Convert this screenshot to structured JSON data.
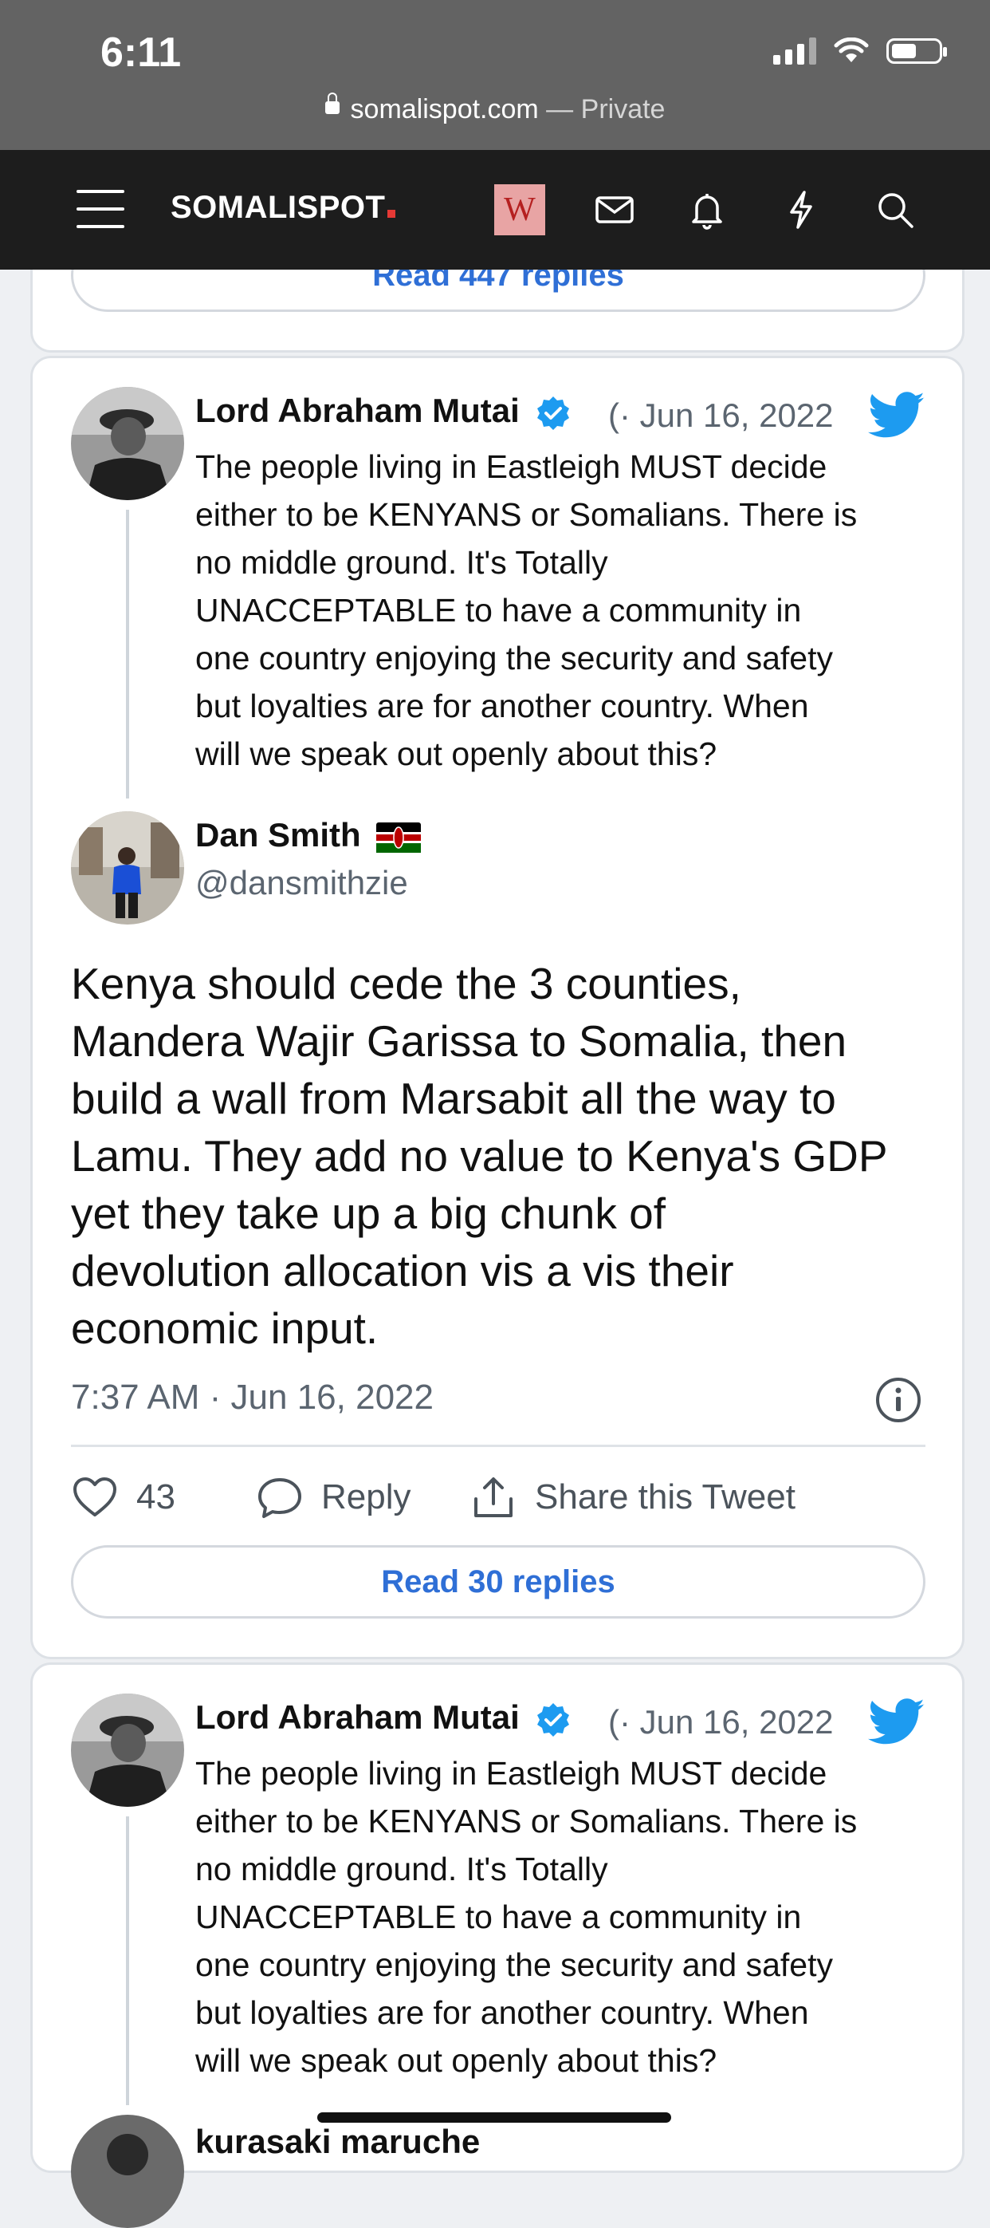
{
  "status_bar": {
    "time": "6:11"
  },
  "url_bar": {
    "domain": "somalispot.com",
    "separator": " — ",
    "mode": "Private"
  },
  "nav": {
    "logo": "SOMALISPOT",
    "user_initial": "W"
  },
  "colors": {
    "accent": "#2f6fd6",
    "twitter_blue": "#1d9bf0",
    "nav_bg": "#1d1d1d",
    "logo_dot": "#e53935"
  },
  "card_top": {
    "read_replies_label": "Read 447 replies"
  },
  "card_main": {
    "quoted": {
      "author": "Lord Abraham Mutai",
      "meta": "(· Jun 16, 2022",
      "lines": [
        "The people living in Eastleigh MUST decide",
        "either to be KENYANS or Somalians. There is",
        "no middle ground. It's Totally",
        "UNACCEPTABLE to have a community in",
        "one country enjoying the security and safety",
        "but loyalties are for another country. When",
        "will we speak out openly about this?"
      ]
    },
    "reply": {
      "author": "Dan Smith",
      "handle": "@dansmithzie",
      "lines": [
        "Kenya should cede the 3 counties,",
        "Mandera Wajir Garissa to Somalia, then",
        "build a wall from Marsabit all the way to",
        "Lamu. They add no value to Kenya's GDP",
        "yet they take up a big chunk of",
        "devolution allocation vis a vis their",
        "economic input."
      ],
      "timestamp": "7:37 AM · Jun 16, 2022"
    },
    "actions": {
      "likes": "43",
      "reply": "Reply",
      "share": "Share this Tweet"
    },
    "read_replies_label": "Read 30 replies"
  },
  "card_bottom": {
    "quoted": {
      "author": "Lord Abraham Mutai",
      "meta": "(· Jun 16, 2022",
      "lines": [
        "The people living in Eastleigh MUST decide",
        "either to be KENYANS or Somalians. There is",
        "no middle ground. It's Totally",
        "UNACCEPTABLE to have a community in",
        "one country enjoying the security and safety",
        "but loyalties are for another country. When",
        "will we speak out openly about this?"
      ]
    },
    "next_author": "kurasaki maruche"
  }
}
